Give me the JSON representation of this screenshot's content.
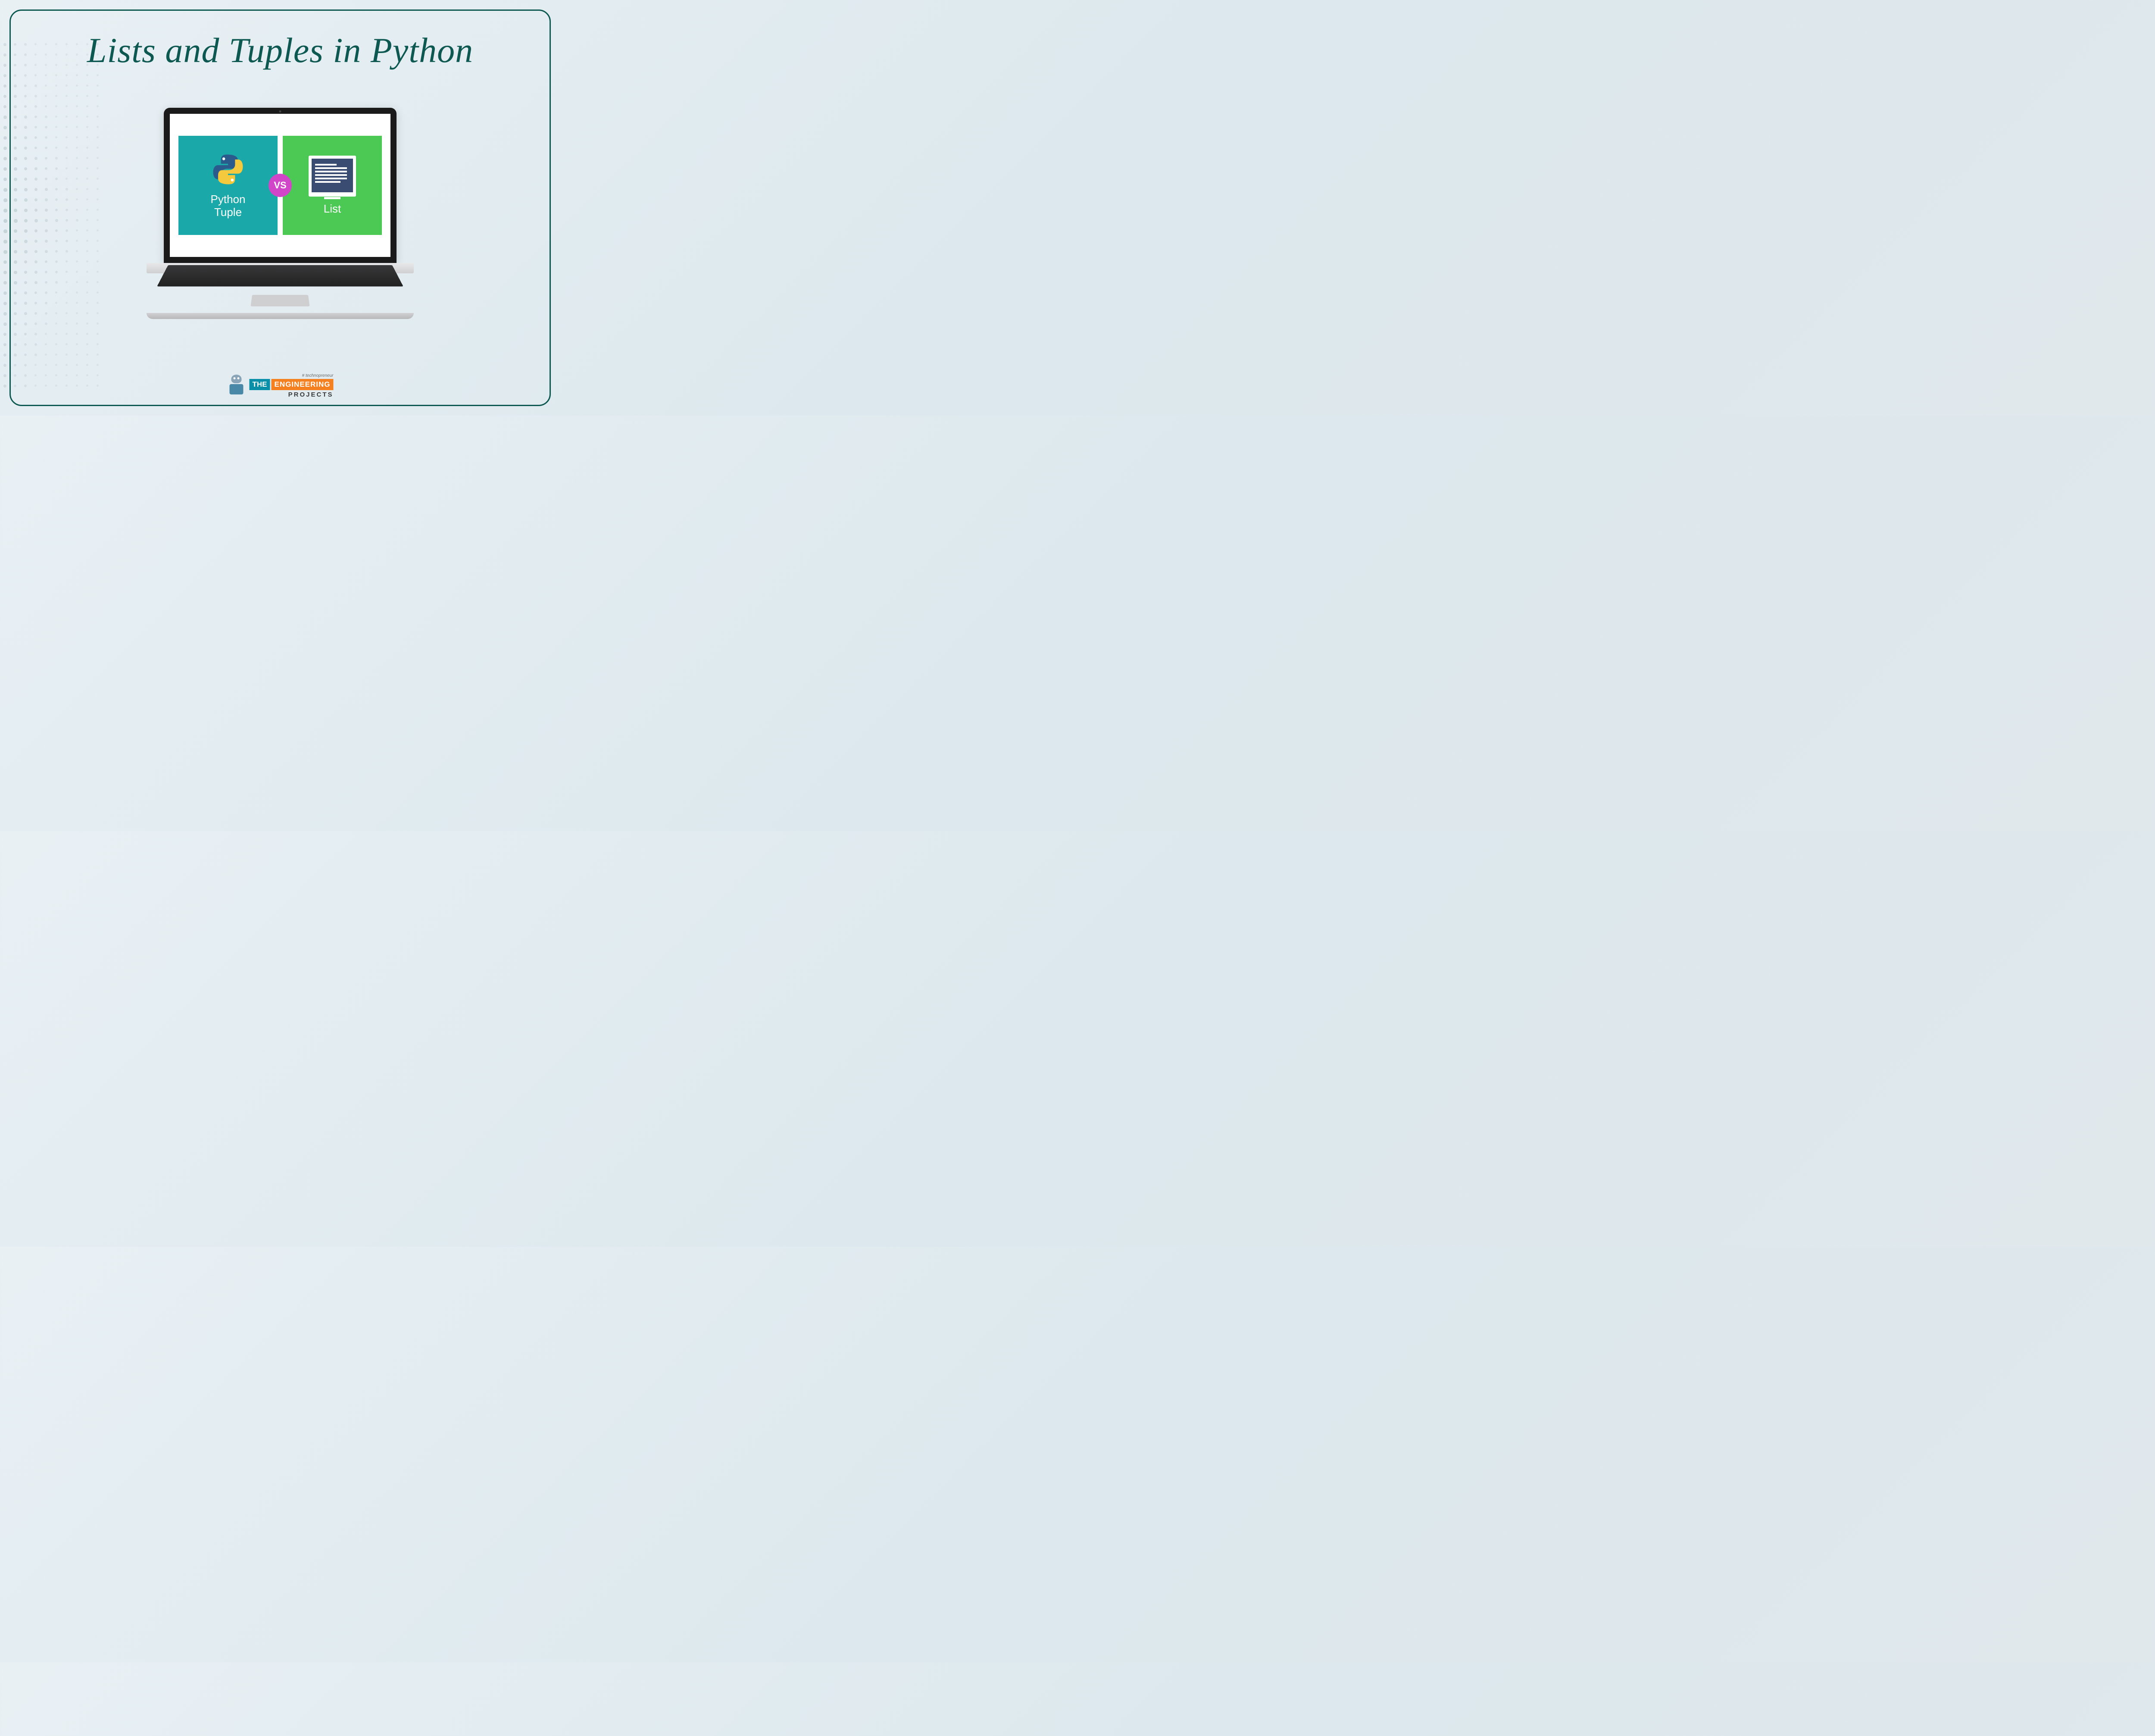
{
  "title": "Lists and Tuples in Python",
  "laptop": {
    "tuple_card": {
      "label": "Python\nTuple"
    },
    "vs_label": "VS",
    "list_card": {
      "label": "List"
    }
  },
  "footer": {
    "tagline": "# technopreneur",
    "logo_the": "THE",
    "logo_engineering": "ENGINEERING",
    "logo_projects": "PROJECTS"
  }
}
